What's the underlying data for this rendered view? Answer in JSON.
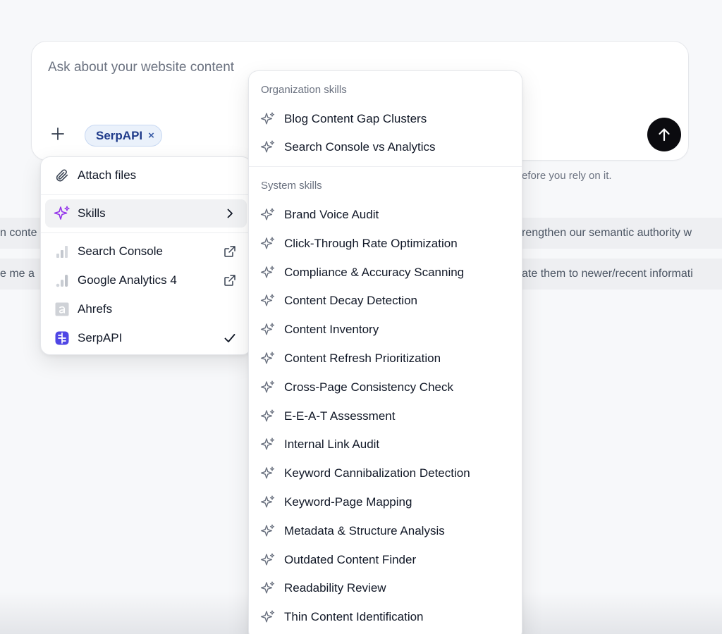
{
  "composer": {
    "placeholder": "Ask about your website content",
    "chip_label": "SerpAPI",
    "chip_close": "×"
  },
  "background": {
    "strip1_left": "n conte",
    "strip1_right": "rengthen our semantic authority w",
    "strip2_left": "e me a",
    "strip2_right": "ate them to newer/recent informati",
    "disclaimer_fragment": "efore you rely on it."
  },
  "menu": {
    "attach_label": "Attach files",
    "skills_label": "Skills",
    "integrations": [
      {
        "label": "Search Console",
        "icon": "search-console-icon",
        "trailing": "external-link-icon"
      },
      {
        "label": "Google Analytics 4",
        "icon": "analytics-icon",
        "trailing": "external-link-icon"
      },
      {
        "label": "Ahrefs",
        "icon": "ahrefs-icon",
        "trailing": ""
      },
      {
        "label": "SerpAPI",
        "icon": "serpapi-icon",
        "trailing": "checkmark-icon"
      }
    ]
  },
  "skills": {
    "org_heading": "Organization skills",
    "org_items": [
      "Blog Content Gap Clusters",
      "Search Console vs Analytics"
    ],
    "system_heading": "System skills",
    "system_items": [
      "Brand Voice Audit",
      "Click-Through Rate Optimization",
      "Compliance & Accuracy Scanning",
      "Content Decay Detection",
      "Content Inventory",
      "Content Refresh Prioritization",
      "Cross-Page Consistency Check",
      "E-E-A-T Assessment",
      "Internal Link Audit",
      "Keyword Cannibalization Detection",
      "Keyword-Page Mapping",
      "Metadata & Structure Analysis",
      "Outdated Content Finder",
      "Readability Review",
      "Thin Content Identification"
    ]
  },
  "colors": {
    "skills_accent": "#9333ea",
    "serpapi_brand": "#4f46e5",
    "chip_bg": "#eaf1fb",
    "send_bg": "#0b0b0f"
  }
}
